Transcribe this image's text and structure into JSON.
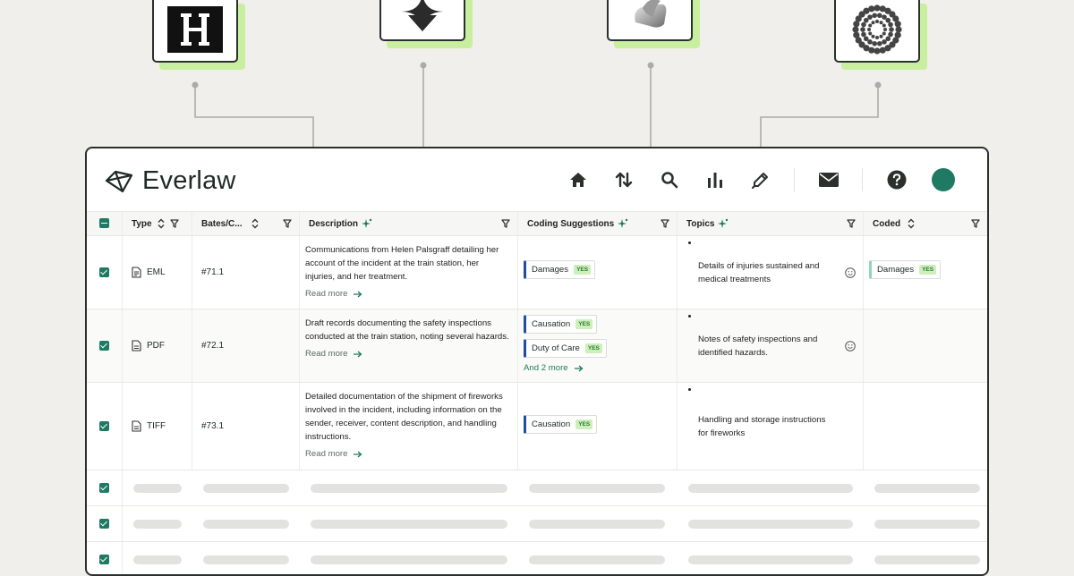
{
  "integrations": [
    {
      "name": "H logo",
      "icon": "h-letter-logo-icon"
    },
    {
      "name": "Dark diamond logo",
      "icon": "diamond-logo-icon"
    },
    {
      "name": "Ribbon logo",
      "icon": "ribbon-logo-icon"
    },
    {
      "name": "Dotted ring logo",
      "icon": "dotted-ring-logo-icon"
    }
  ],
  "app": {
    "brand": "Everlaw",
    "nav_icons": [
      "home-icon",
      "sort-arrows-icon",
      "search-icon",
      "bar-chart-icon",
      "pen-icon",
      "mail-icon",
      "help-icon",
      "avatar"
    ],
    "accent": "#1e7a62"
  },
  "table": {
    "columns": [
      "Type",
      "Bates/C...",
      "Description",
      "Coding Suggestions",
      "Topics",
      "Coded"
    ],
    "read_more": "Read more",
    "yes_badge": "YES",
    "rows": [
      {
        "type": "EML",
        "bates": "#71.1",
        "description": "Communications from Helen Palsgraff detailing her account of the incident at the train station, her injuries, and her treatment.",
        "suggestions": [
          "Damages"
        ],
        "more": "",
        "topic": "Details of injuries sustained and medical treatments",
        "coded": [
          "Damages"
        ]
      },
      {
        "type": "PDF",
        "bates": "#72.1",
        "description": "Draft records documenting the safety inspections conducted at the train station, noting several hazards.",
        "suggestions": [
          "Causation",
          "Duty of Care"
        ],
        "more": "And 2 more",
        "topic": "Notes of safety inspections and identified hazards.",
        "coded": []
      },
      {
        "type": "TIFF",
        "bates": "#73.1",
        "description": "Detailed documentation of the shipment of fireworks involved in the incident, including information on the sender, receiver, content description, and handling instructions.",
        "suggestions": [
          "Causation"
        ],
        "more": "",
        "topic": "Handling and storage instructions for fireworks",
        "coded": []
      }
    ]
  }
}
